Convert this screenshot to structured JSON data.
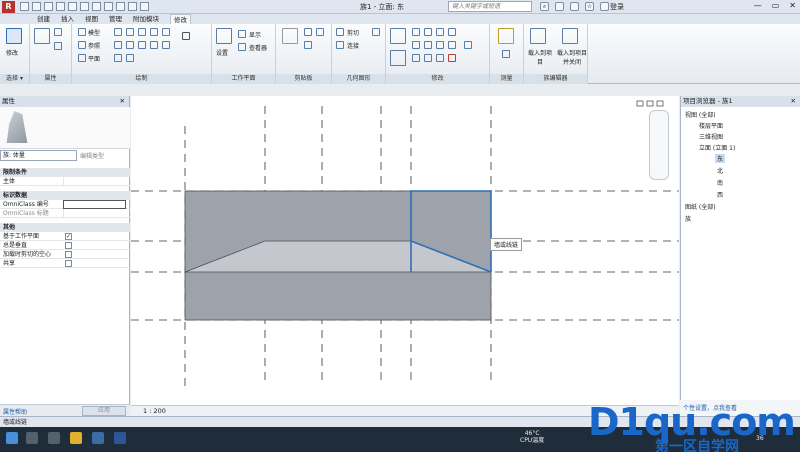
{
  "titlebar": {
    "app_logo": "R",
    "doc_title": "族1 - 立面: 东",
    "search_placeholder": "键入关键字或短语",
    "login_label": "登录",
    "window_controls": [
      "—",
      "▭",
      "✕"
    ]
  },
  "tabs": [
    {
      "label": "创建"
    },
    {
      "label": "插入"
    },
    {
      "label": "视图"
    },
    {
      "label": "管理"
    },
    {
      "label": "附加模块"
    },
    {
      "label": "修改"
    }
  ],
  "ribbon": {
    "modify_button": "修改",
    "panels": [
      {
        "title": "选择 ▾"
      },
      {
        "title": "属性"
      },
      {
        "title": "绘制"
      },
      {
        "title": "工作平面"
      },
      {
        "title": "剪贴板"
      },
      {
        "title": "几何图形"
      },
      {
        "title": "修改"
      },
      {
        "title": "测量"
      },
      {
        "title": "族编辑器"
      }
    ],
    "draw_tools": [
      "模型",
      "参照",
      "平面"
    ],
    "workplane_tools": [
      "设置",
      "显示",
      "查看器"
    ],
    "geometry_tools": [
      "剪切",
      "连接"
    ],
    "family_editor": [
      "载入到项目",
      "载入到项目并关闭"
    ]
  },
  "properties": {
    "header": "属性",
    "close": "✕",
    "type_selector": "族: 体量",
    "edit_type": "编辑类型",
    "rows": [
      {
        "label": "限制条件",
        "category": true
      },
      {
        "label": "主体",
        "value": ""
      },
      {
        "label": "标识数据",
        "category": true
      },
      {
        "label": "OmniClass 编号",
        "value": ""
      },
      {
        "label": "OmniClass 标题",
        "value": ""
      },
      {
        "label": "其他",
        "category": true
      },
      {
        "label": "基于工作平面",
        "checked": true
      },
      {
        "label": "总是垂直",
        "checked": false
      },
      {
        "label": "加载时剪切的空心",
        "checked": false
      },
      {
        "label": "共享",
        "checked": false
      }
    ],
    "help_link": "属性帮助",
    "apply": "应用"
  },
  "canvas": {
    "tooltip": "墙或线链",
    "scale": "1 : 200"
  },
  "browser": {
    "header": "项目浏览器 - 族1",
    "nodes": [
      {
        "label": "视图 (全部)"
      },
      {
        "label": "楼层平面"
      },
      {
        "label": "三维视图"
      },
      {
        "label": "立面 (立面 1)"
      },
      {
        "label": "东"
      },
      {
        "label": "北"
      },
      {
        "label": "南"
      },
      {
        "label": "西"
      },
      {
        "label": "图纸 (全部)"
      },
      {
        "label": "族"
      }
    ],
    "hint": "个性设置，点我查看"
  },
  "status_bar": "墙或线链",
  "taskbar": {
    "cpu_temp": "46°C",
    "cpu_label": "CPU温度",
    "time": "36"
  },
  "watermark": {
    "text": "D1qu.com",
    "sub": "第一区自学网"
  },
  "colors": {
    "accent": "#2f6fb5",
    "mass_fill": "#9ea3ab",
    "mass_light": "#c4c8ce",
    "selection": "#2f6fb5"
  }
}
